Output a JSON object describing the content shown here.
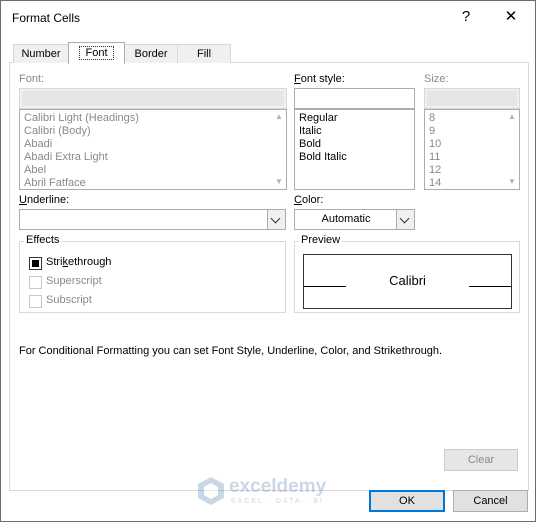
{
  "window": {
    "title": "Format Cells",
    "help_symbol": "?",
    "close_symbol": "✕"
  },
  "tabs": [
    {
      "label": "Number"
    },
    {
      "label": "Font"
    },
    {
      "label": "Border"
    },
    {
      "label": "Fill"
    }
  ],
  "font": {
    "label": "Font:",
    "value": "",
    "items": [
      "Calibri Light (Headings)",
      "Calibri (Body)",
      "Abadi",
      "Abadi Extra Light",
      "Abel",
      "Abril Fatface"
    ]
  },
  "font_style": {
    "label_prefix": "F",
    "label_rest": "ont style:",
    "value": "",
    "items": [
      "Regular",
      "Italic",
      "Bold",
      "Bold Italic"
    ]
  },
  "size": {
    "label": "Size:",
    "value": "",
    "items": [
      "8",
      "9",
      "10",
      "11",
      "12",
      "14"
    ]
  },
  "underline": {
    "label_prefix": "U",
    "label_rest": "nderline:",
    "value": ""
  },
  "color": {
    "label_prefix": "C",
    "label_rest": "olor:",
    "value": "Automatic"
  },
  "effects": {
    "title": "Effects",
    "strikethrough": {
      "pre": "Stri",
      "key": "k",
      "post": "ethrough",
      "state": "indeterminate"
    },
    "superscript": {
      "label": "Superscript"
    },
    "subscript": {
      "label": "Subscript"
    }
  },
  "preview": {
    "title": "Preview",
    "sample": "Calibri"
  },
  "info_text": "For Conditional Formatting you can set Font Style, Underline, Color, and Strikethrough.",
  "buttons": {
    "clear": "Clear",
    "ok": "OK",
    "cancel": "Cancel"
  },
  "watermark": {
    "name": "exceldemy",
    "tagline": "EXCEL · DATA · BI"
  },
  "colors": {
    "accent": "#0078d7",
    "disabled_text": "#8a8a8a"
  }
}
